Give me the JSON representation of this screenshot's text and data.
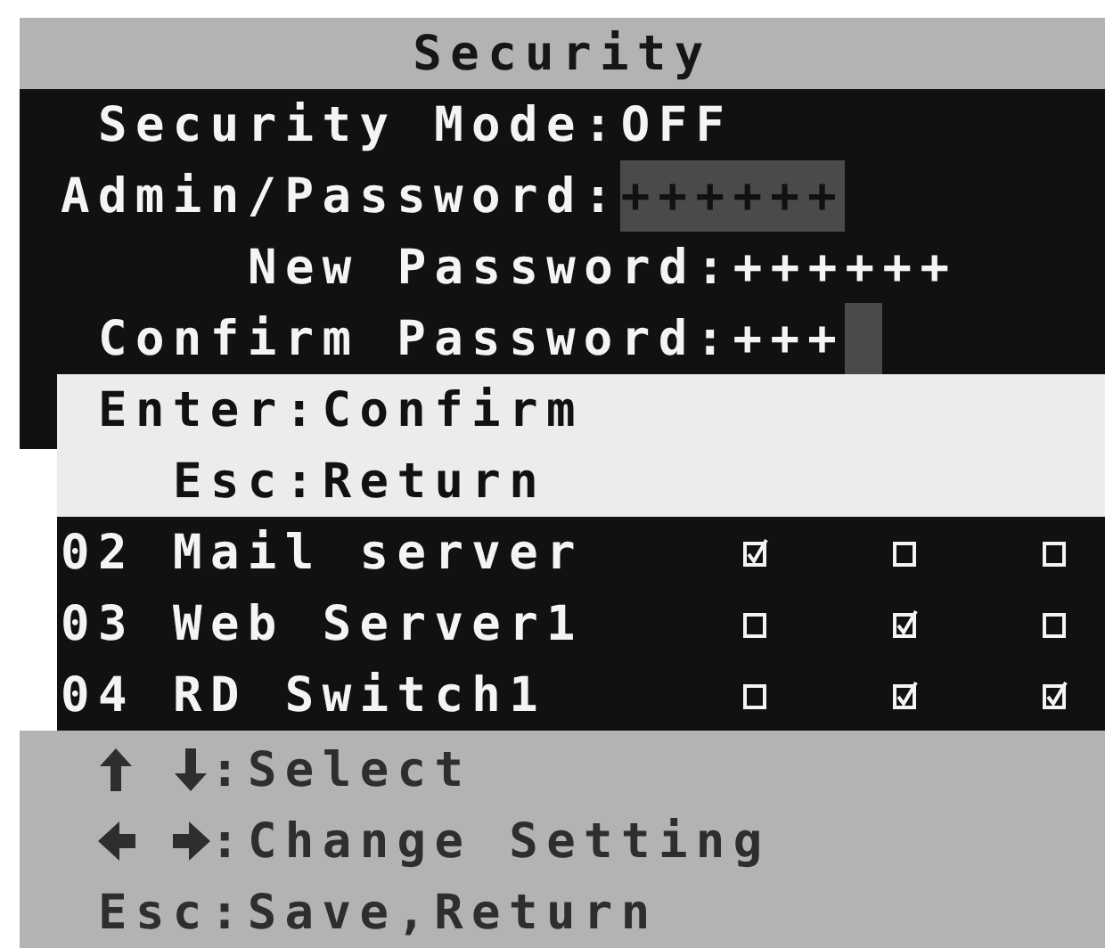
{
  "title": "Security",
  "fields": [
    {
      "label": "Security Mode:",
      "value": "OFF",
      "highlighted": false
    },
    {
      "label": "Admin/Password:",
      "value": "++++++",
      "highlighted": true
    }
  ],
  "dialog": {
    "fields": [
      {
        "label": "New Password:",
        "value": "++++++",
        "cursor": false
      },
      {
        "label": "Confirm Password:",
        "value": "+++",
        "cursor": true
      }
    ],
    "hints": [
      {
        "text": "Enter:Confirm"
      },
      {
        "text": "Esc:Return"
      }
    ]
  },
  "rows": [
    {
      "number": "02",
      "name": "Mail server",
      "checks": [
        {
          "checked": true
        },
        {
          "checked": false
        },
        {
          "checked": false
        }
      ]
    },
    {
      "number": "03",
      "name": "Web Server1",
      "checks": [
        {
          "checked": false
        },
        {
          "checked": true
        },
        {
          "checked": false
        }
      ]
    },
    {
      "number": "04",
      "name": "RD Switch1",
      "checks": [
        {
          "checked": false
        },
        {
          "checked": true
        },
        {
          "checked": true
        }
      ]
    }
  ],
  "help": [
    {
      "kind": "vertical-arrows",
      "text": ":Select"
    },
    {
      "kind": "horizontal-arrows",
      "text": ":Change Setting"
    },
    {
      "kind": "text",
      "text": "Esc:Save,Return"
    }
  ]
}
